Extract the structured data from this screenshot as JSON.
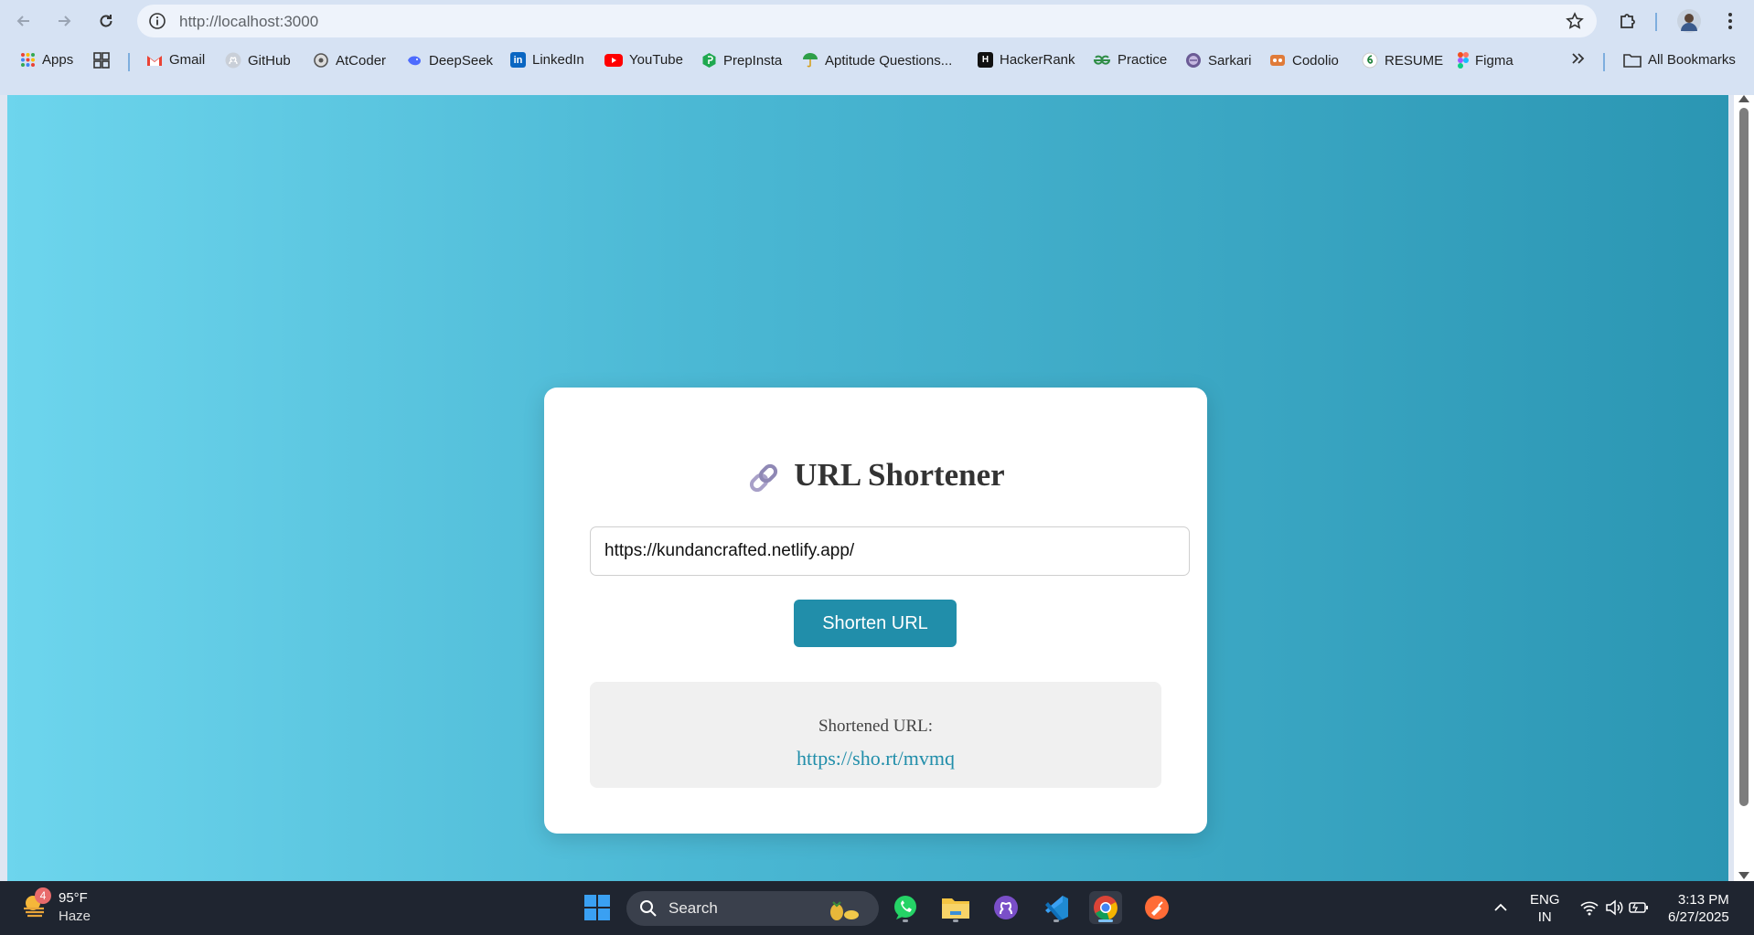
{
  "browser": {
    "url": "http://localhost:3000",
    "bookmarks": [
      {
        "label": "Apps",
        "icon": "apps-grid-icon"
      },
      {
        "label": "Gmail",
        "icon": "gmail-icon"
      },
      {
        "label": "GitHub",
        "icon": "github-icon"
      },
      {
        "label": "AtCoder",
        "icon": "atcoder-icon"
      },
      {
        "label": "DeepSeek",
        "icon": "deepseek-icon"
      },
      {
        "label": "LinkedIn",
        "icon": "linkedin-icon"
      },
      {
        "label": "YouTube",
        "icon": "youtube-icon"
      },
      {
        "label": "PrepInsta",
        "icon": "prepinsta-icon"
      },
      {
        "label": "Aptitude Questions...",
        "icon": "umbrella-icon"
      },
      {
        "label": "HackerRank",
        "icon": "hackerrank-icon"
      },
      {
        "label": "Practice",
        "icon": "gfg-icon"
      },
      {
        "label": "Sarkari",
        "icon": "sarkari-icon"
      },
      {
        "label": "Codolio",
        "icon": "codolio-icon"
      },
      {
        "label": "RESUME",
        "icon": "resume-icon"
      },
      {
        "label": "Figma",
        "icon": "figma-icon"
      }
    ],
    "all_bookmarks_label": "All Bookmarks",
    "colors": {
      "accent": "#218eaa",
      "gradient_start": "#6dd5ed",
      "gradient_end": "#2b96b3"
    }
  },
  "app": {
    "title": "URL Shortener",
    "title_icon": "link-icon",
    "input_value": "https://kundancrafted.netlify.app/",
    "button_label": "Shorten URL",
    "result_label": "Shortened URL:",
    "result_url": "https://sho.rt/mvmq"
  },
  "taskbar": {
    "weather_badge": "4",
    "weather_temp": "95°F",
    "weather_condition": "Haze",
    "search_label": "Search",
    "lang_line1": "ENG",
    "lang_line2": "IN",
    "time": "3:13 PM",
    "date": "6/27/2025"
  }
}
